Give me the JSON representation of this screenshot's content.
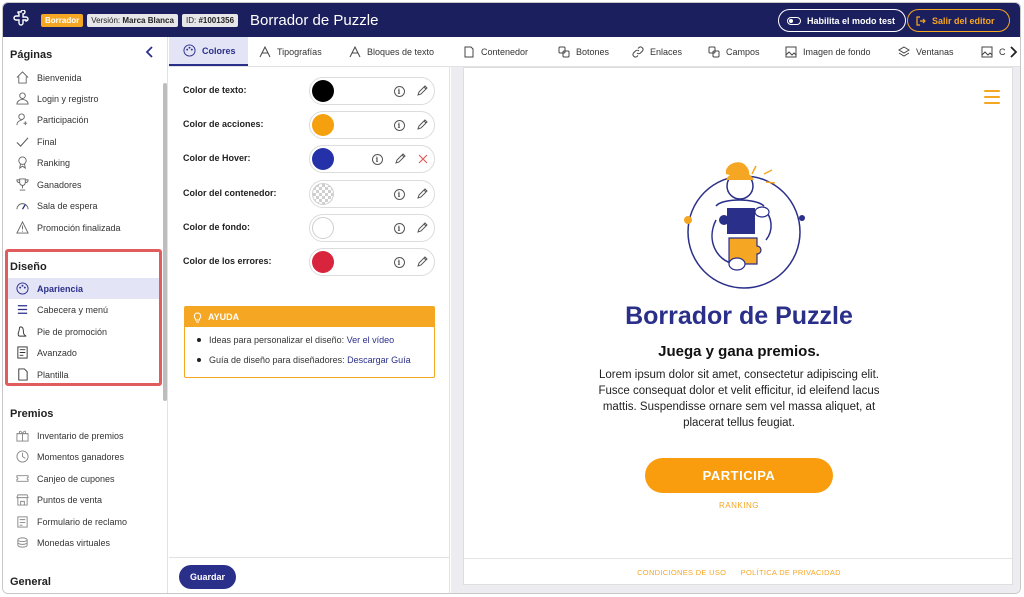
{
  "header": {
    "status_badge": "Borrador",
    "version_label": "Versión:",
    "version_value": "Marca Blanca",
    "id_label": "ID:",
    "id_value": "#1001356",
    "title": "Borrador de Puzzle",
    "test_mode_label": "Habilita el modo test",
    "exit_label": "Salir del editor"
  },
  "sidebar": {
    "pages_title": "Páginas",
    "pages": [
      {
        "label": "Bienvenida",
        "icon": "home-icon"
      },
      {
        "label": "Login y registro",
        "icon": "user-icon"
      },
      {
        "label": "Participación",
        "icon": "user-icon"
      },
      {
        "label": "Final",
        "icon": "check-icon"
      },
      {
        "label": "Ranking",
        "icon": "medal-icon"
      },
      {
        "label": "Ganadores",
        "icon": "trophy-icon"
      },
      {
        "label": "Sala de espera",
        "icon": "gauge-icon"
      },
      {
        "label": "Promoción finalizada",
        "icon": "warning-icon"
      }
    ],
    "design_title": "Diseño",
    "design": [
      {
        "label": "Apariencia",
        "icon": "palette-icon"
      },
      {
        "label": "Cabecera y menú",
        "icon": "menu-icon"
      },
      {
        "label": "Pie de promoción",
        "icon": "foot-icon"
      },
      {
        "label": "Avanzado",
        "icon": "code-icon"
      },
      {
        "label": "Plantilla",
        "icon": "document-icon"
      }
    ],
    "prizes_title": "Premios",
    "prizes": [
      {
        "label": "Inventario de premios",
        "icon": "gift-icon"
      },
      {
        "label": "Momentos ganadores",
        "icon": "clock-icon"
      },
      {
        "label": "Canjeo de cupones",
        "icon": "ticket-icon"
      },
      {
        "label": "Puntos de venta",
        "icon": "store-icon"
      },
      {
        "label": "Formulario de reclamo",
        "icon": "form-icon"
      },
      {
        "label": "Monedas virtuales",
        "icon": "coins-icon"
      }
    ],
    "general_title": "General"
  },
  "tabs": [
    {
      "label": "Colores",
      "icon": "palette-icon"
    },
    {
      "label": "Tipografías",
      "icon": "type-icon"
    },
    {
      "label": "Bloques de texto",
      "icon": "text-block-icon"
    },
    {
      "label": "Contenedor",
      "icon": "container-icon"
    },
    {
      "label": "Botones",
      "icon": "buttons-icon"
    },
    {
      "label": "Enlaces",
      "icon": "link-icon"
    },
    {
      "label": "Campos",
      "icon": "fields-icon"
    },
    {
      "label": "Imagen de fondo",
      "icon": "image-icon"
    },
    {
      "label": "Ventanas",
      "icon": "layers-icon"
    },
    {
      "label": "C",
      "icon": "image-icon"
    }
  ],
  "colors": [
    {
      "label": "Color de texto:",
      "value": "#000000",
      "removable": false
    },
    {
      "label": "Color de acciones:",
      "value": "#f5a00f",
      "removable": false
    },
    {
      "label": "Color de Hover:",
      "value": "#2431a8",
      "removable": true
    },
    {
      "label": "Color del contenedor:",
      "value": "transparent",
      "removable": false
    },
    {
      "label": "Color de fondo:",
      "value": "#ffffff",
      "removable": false
    },
    {
      "label": "Color de los errores:",
      "value": "#d8243c",
      "removable": false
    }
  ],
  "help": {
    "title": "AYUDA",
    "items": [
      {
        "text": "Ideas para personalizar el diseño:",
        "link": "Ver el vídeo"
      },
      {
        "text": "Guía de diseño para diseñadores:",
        "link": "Descargar Guía"
      }
    ]
  },
  "save_label": "Guardar",
  "preview": {
    "title": "Borrador de Puzzle",
    "subtitle": "Juega y gana premios.",
    "body": "Lorem ipsum dolor sit amet, consectetur adipiscing elit. Fusce consequat dolor et velit efficitur, id eleifend lacus mattis. Suspendisse ornare sem vel massa aliquet, at placerat tellus feugiat.",
    "cta": "PARTICIPA",
    "ranking": "RANKING",
    "terms": "CONDICIONES DE USO",
    "privacy": "POLÍTICA DE PRIVACIDAD"
  },
  "theme": {
    "brand_navy": "#1c1f5e",
    "accent_indigo": "#2a2f8a",
    "accent_orange": "#f5a623",
    "highlight_red": "#e15d5d"
  }
}
